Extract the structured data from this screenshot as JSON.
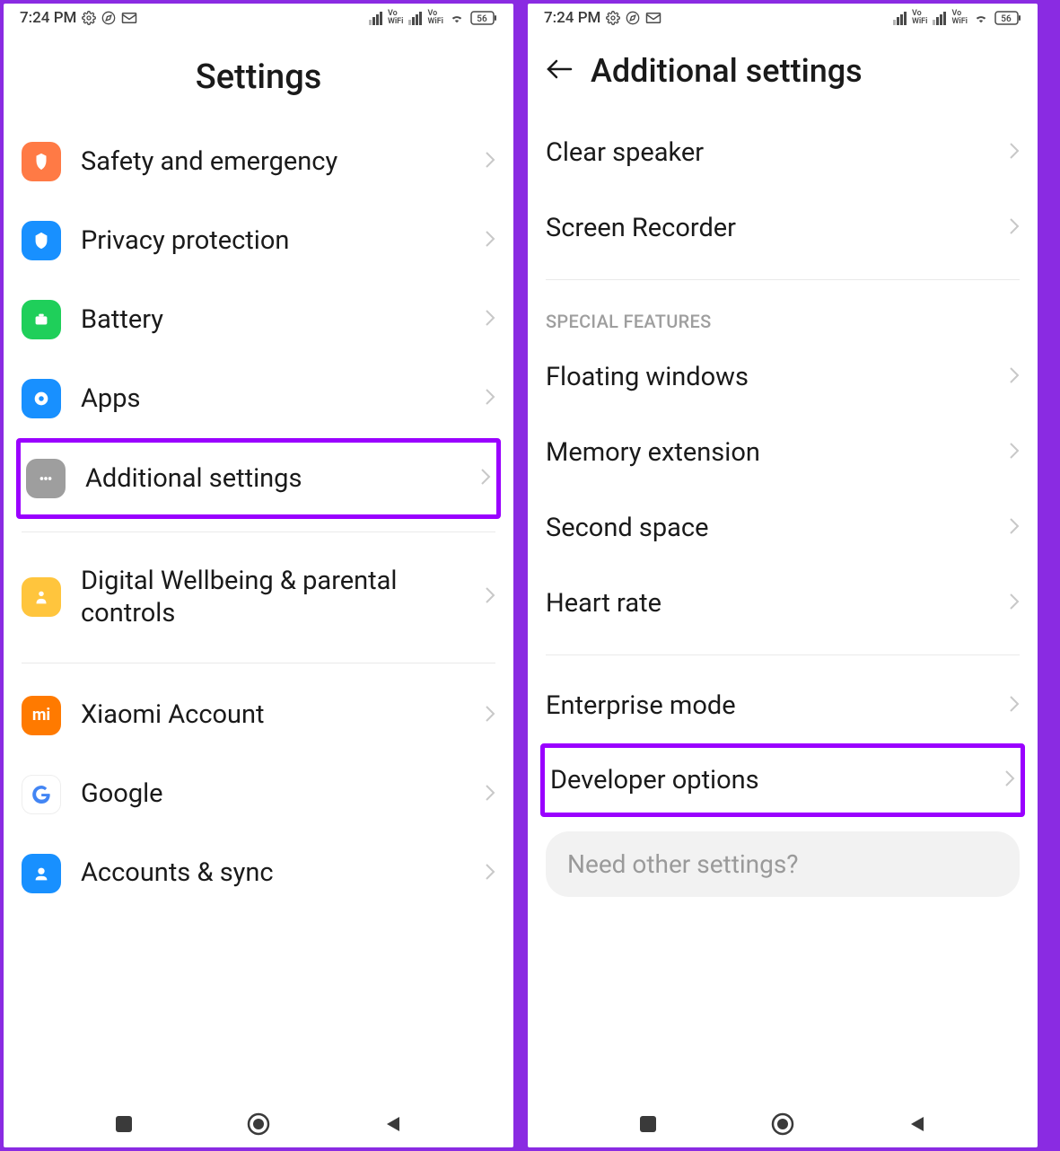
{
  "status": {
    "time": "7:24 PM",
    "battery": "56"
  },
  "left": {
    "title": "Settings",
    "items": [
      {
        "label": "Safety and emergency",
        "icon": "safety",
        "color": "#ff7a45"
      },
      {
        "label": "Privacy protection",
        "icon": "privacy",
        "color": "#1890ff"
      },
      {
        "label": "Battery",
        "icon": "battery",
        "color": "#1fcf5a"
      },
      {
        "label": "Apps",
        "icon": "apps",
        "color": "#1890ff"
      },
      {
        "label": "Additional settings",
        "icon": "additional",
        "color": "#9e9e9e",
        "highlight": true
      }
    ],
    "items2": [
      {
        "label": "Digital Wellbeing & parental controls",
        "icon": "wellbeing",
        "color": "#ffc53d"
      }
    ],
    "items3": [
      {
        "label": "Xiaomi Account",
        "icon": "xiaomi",
        "color": "#ff7a00"
      },
      {
        "label": "Google",
        "icon": "google",
        "color": "#ffffff"
      },
      {
        "label": "Accounts & sync",
        "icon": "accounts",
        "color": "#1890ff"
      }
    ]
  },
  "right": {
    "title": "Additional settings",
    "items": [
      {
        "label": "Clear speaker"
      },
      {
        "label": "Screen Recorder"
      }
    ],
    "section_label": "SPECIAL FEATURES",
    "items2": [
      {
        "label": "Floating windows"
      },
      {
        "label": "Memory extension"
      },
      {
        "label": "Second space"
      },
      {
        "label": "Heart rate"
      }
    ],
    "items3": [
      {
        "label": "Enterprise mode"
      },
      {
        "label": "Developer options",
        "highlight": true
      }
    ],
    "search_hint": "Need other settings?"
  }
}
